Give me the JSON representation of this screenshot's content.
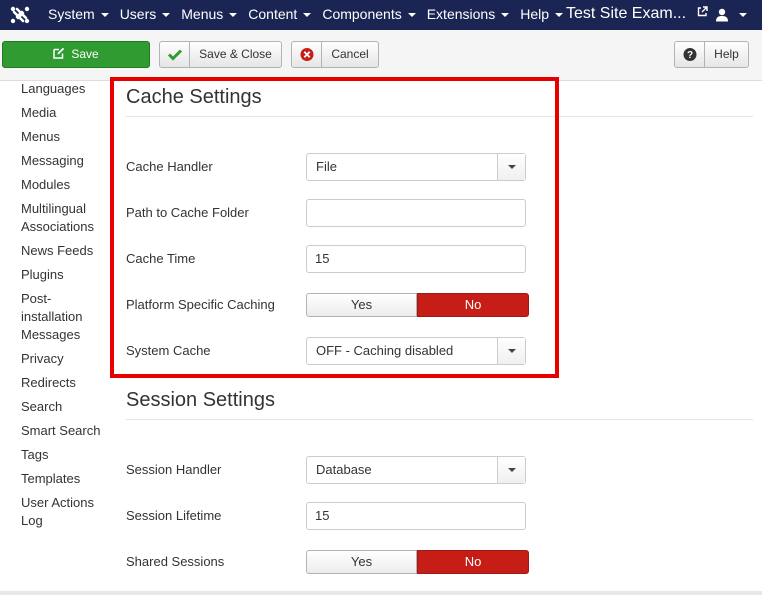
{
  "navbar": {
    "menus": [
      "System",
      "Users",
      "Menus",
      "Content",
      "Components",
      "Extensions",
      "Help"
    ],
    "site_name": "Test Site Exam...",
    "icons": {
      "logo": "joomla-logo-icon",
      "external": "external-link-icon",
      "user": "user-icon"
    }
  },
  "toolbar": {
    "save_label": "Save",
    "save_close_label": "Save & Close",
    "cancel_label": "Cancel",
    "help_label": "Help"
  },
  "sidebar": {
    "items": [
      "Languages",
      "Media",
      "Menus",
      "Messaging",
      "Modules",
      "Multilingual Associations",
      "News Feeds",
      "Plugins",
      "Post-installation Messages",
      "Privacy",
      "Redirects",
      "Search",
      "Smart Search",
      "Tags",
      "Templates",
      "User Actions Log"
    ]
  },
  "cache": {
    "title": "Cache Settings",
    "handler_label": "Cache Handler",
    "handler_value": "File",
    "path_label": "Path to Cache Folder",
    "path_value": "",
    "time_label": "Cache Time",
    "time_value": "15",
    "platform_label": "Platform Specific Caching",
    "platform_yes": "Yes",
    "platform_no": "No",
    "platform_selected": "No",
    "system_label": "System Cache",
    "system_value": "OFF - Caching disabled"
  },
  "session": {
    "title": "Session Settings",
    "handler_label": "Session Handler",
    "handler_value": "Database",
    "lifetime_label": "Session Lifetime",
    "lifetime_value": "15",
    "shared_label": "Shared Sessions",
    "shared_yes": "Yes",
    "shared_no": "No",
    "shared_selected": "No"
  },
  "colors": {
    "navbar": "#1b2553",
    "save": "#2f9b31",
    "toggle_active": "#c61d17",
    "highlight": "#e60000"
  }
}
